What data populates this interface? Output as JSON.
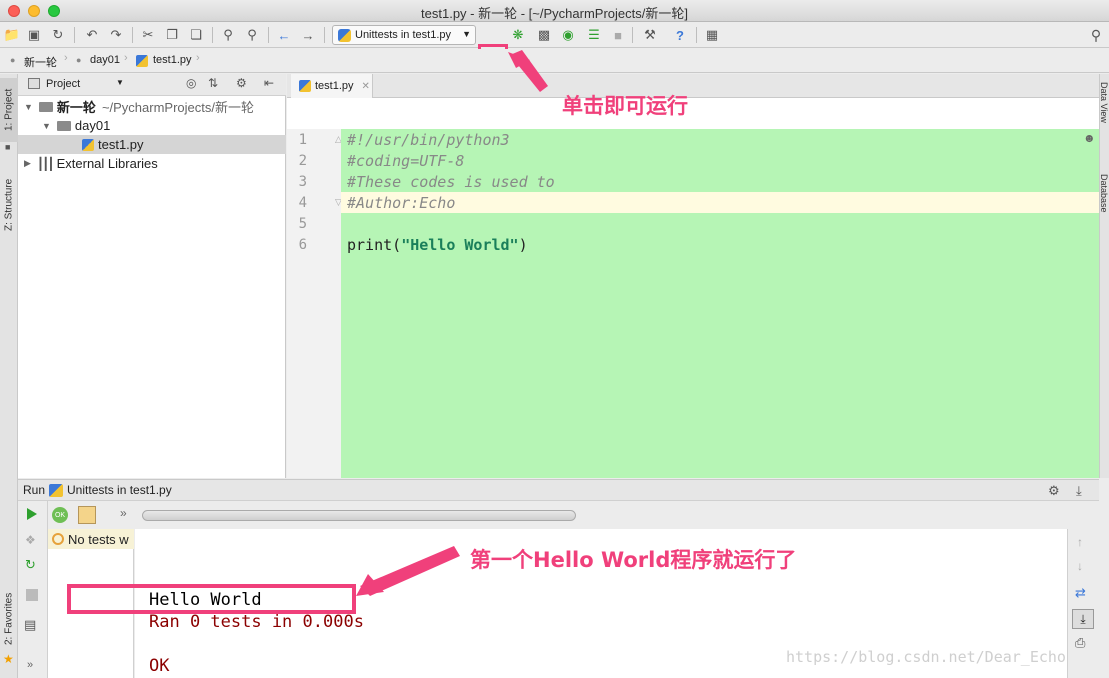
{
  "window": {
    "title": "test1.py - 新一轮 - [~/PycharmProjects/新一轮]"
  },
  "toolbar": {
    "run_config": "Unittests in test1.py"
  },
  "navbar": {
    "crumbs": [
      "新一轮",
      "day01",
      "test1.py"
    ]
  },
  "side_tabs": {
    "project": "1: Project",
    "structure": "Z: Structure",
    "favorites": "2: Favorites",
    "data_view": "Data View",
    "database": "Database"
  },
  "project": {
    "header": "Project",
    "tree": [
      {
        "label": "新一轮",
        "suffix": "~/PycharmProjects/新一轮"
      },
      {
        "label": "day01"
      },
      {
        "label": "test1.py"
      },
      {
        "label": "External Libraries"
      }
    ]
  },
  "editor": {
    "tab": "test1.py",
    "lines": [
      {
        "n": "1",
        "text": "#!/usr/bin/python3",
        "kind": "comment"
      },
      {
        "n": "2",
        "text": "#coding=UTF-8",
        "kind": "comment"
      },
      {
        "n": "3",
        "text": "#These codes is used to",
        "kind": "comment"
      },
      {
        "n": "4",
        "text": "#Author:Echo",
        "kind": "comment"
      },
      {
        "n": "5",
        "text": "",
        "kind": "blank"
      },
      {
        "n": "6",
        "text": "print(\"Hello World\")",
        "kind": "code"
      }
    ],
    "print_fn": "print(",
    "print_str": "\"Hello World\"",
    "print_close": ")"
  },
  "run": {
    "header_prefix": "Run",
    "header_config": "Unittests in test1.py",
    "status": "No tests w",
    "output": [
      "Hello World",
      "Ran 0 tests in 0.000s",
      "",
      "OK"
    ]
  },
  "annotations": {
    "run_hint": "单击即可运行",
    "output_hint": "第一个Hello World程序就运行了"
  },
  "watermark": "https://blog.csdn.net/Dear_Echo",
  "colors": {
    "accent": "#f0407b",
    "code_bg": "#b6f5b5",
    "run_green": "#2ea02e",
    "string": "#1a7f5a"
  }
}
